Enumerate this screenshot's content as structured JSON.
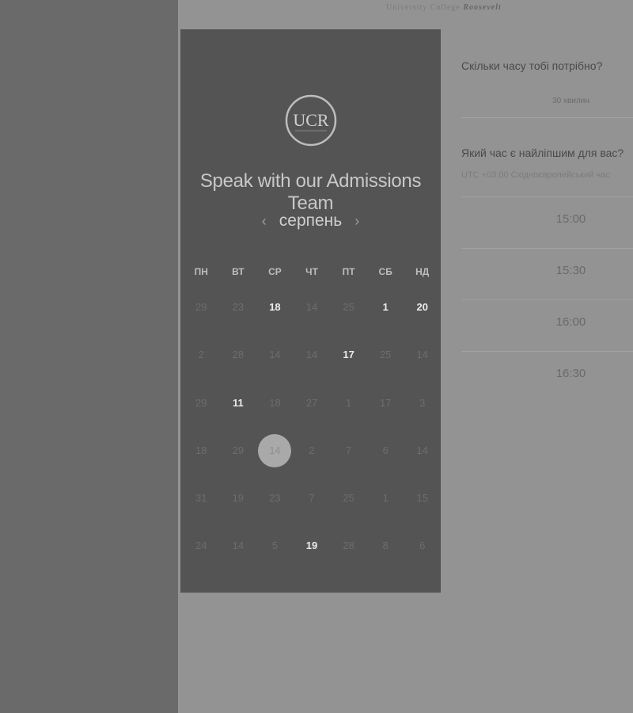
{
  "brand": {
    "prefix": "University College",
    "name": "Roosevelt"
  },
  "panel": {
    "logo_text": "UCR",
    "headline": "Speak with our Admissions Team",
    "month": "серпень",
    "prev_arrow": "‹",
    "next_arrow": "›",
    "weekdays": [
      "ПН",
      "ВТ",
      "СР",
      "ЧТ",
      "ПТ",
      "СБ",
      "НД"
    ],
    "weeks": [
      [
        {
          "d": "29",
          "a": false
        },
        {
          "d": "23",
          "a": false
        },
        {
          "d": "18",
          "a": true
        },
        {
          "d": "14",
          "a": false
        },
        {
          "d": "25",
          "a": false
        },
        {
          "d": "1",
          "a": true
        },
        {
          "d": "20",
          "a": true
        }
      ],
      [
        {
          "d": "2",
          "a": false
        },
        {
          "d": "28",
          "a": false
        },
        {
          "d": "14",
          "a": false
        },
        {
          "d": "14",
          "a": false
        },
        {
          "d": "17",
          "a": true
        },
        {
          "d": "25",
          "a": false
        },
        {
          "d": "14",
          "a": false
        }
      ],
      [
        {
          "d": "29",
          "a": false
        },
        {
          "d": "11",
          "a": true
        },
        {
          "d": "18",
          "a": false
        },
        {
          "d": "27",
          "a": false
        },
        {
          "d": "1",
          "a": false
        },
        {
          "d": "17",
          "a": false
        },
        {
          "d": "3",
          "a": false
        }
      ],
      [
        {
          "d": "18",
          "a": false
        },
        {
          "d": "29",
          "a": false
        },
        {
          "d": "14",
          "a": false,
          "s": true
        },
        {
          "d": "2",
          "a": false
        },
        {
          "d": "7",
          "a": false
        },
        {
          "d": "6",
          "a": false
        },
        {
          "d": "14",
          "a": false
        }
      ],
      [
        {
          "d": "31",
          "a": false
        },
        {
          "d": "19",
          "a": false
        },
        {
          "d": "23",
          "a": false
        },
        {
          "d": "7",
          "a": false
        },
        {
          "d": "25",
          "a": false
        },
        {
          "d": "1",
          "a": false
        },
        {
          "d": "15",
          "a": false
        }
      ],
      [
        {
          "d": "24",
          "a": false
        },
        {
          "d": "14",
          "a": false
        },
        {
          "d": "5",
          "a": false
        },
        {
          "d": "19",
          "a": true
        },
        {
          "d": "28",
          "a": false
        },
        {
          "d": "8",
          "a": false
        },
        {
          "d": "6",
          "a": false
        }
      ]
    ]
  },
  "right": {
    "question_duration": "Скільки часу тобі потрібно?",
    "duration_value": "30 хвилин",
    "question_time": "Який час є найліпшим для вас?",
    "timezone": "UTC +03:00 Східноєвропейський час",
    "slots": [
      "15:00",
      "15:30",
      "16:00",
      "16:30"
    ]
  }
}
